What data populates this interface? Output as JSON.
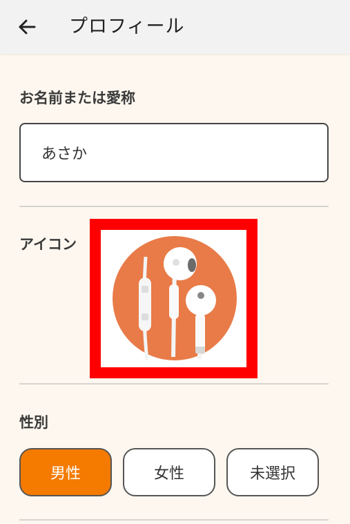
{
  "header": {
    "title": "プロフィール",
    "back_icon": "arrow-left-icon"
  },
  "name_section": {
    "label": "お名前または愛称",
    "value": "あさか",
    "placeholder": ""
  },
  "icon_section": {
    "label": "アイコン",
    "avatar_icon": "earphones-icon",
    "highlight_color": "#FF0000",
    "avatar_bg_color": "#E87B48"
  },
  "gender_section": {
    "label": "性別",
    "options": [
      {
        "label": "男性",
        "selected": true
      },
      {
        "label": "女性",
        "selected": false
      },
      {
        "label": "未選択",
        "selected": false
      }
    ],
    "selected_color": "#F47A00"
  },
  "colors": {
    "background": "#FDF7EF",
    "app_bar": "#F2F2F2"
  }
}
